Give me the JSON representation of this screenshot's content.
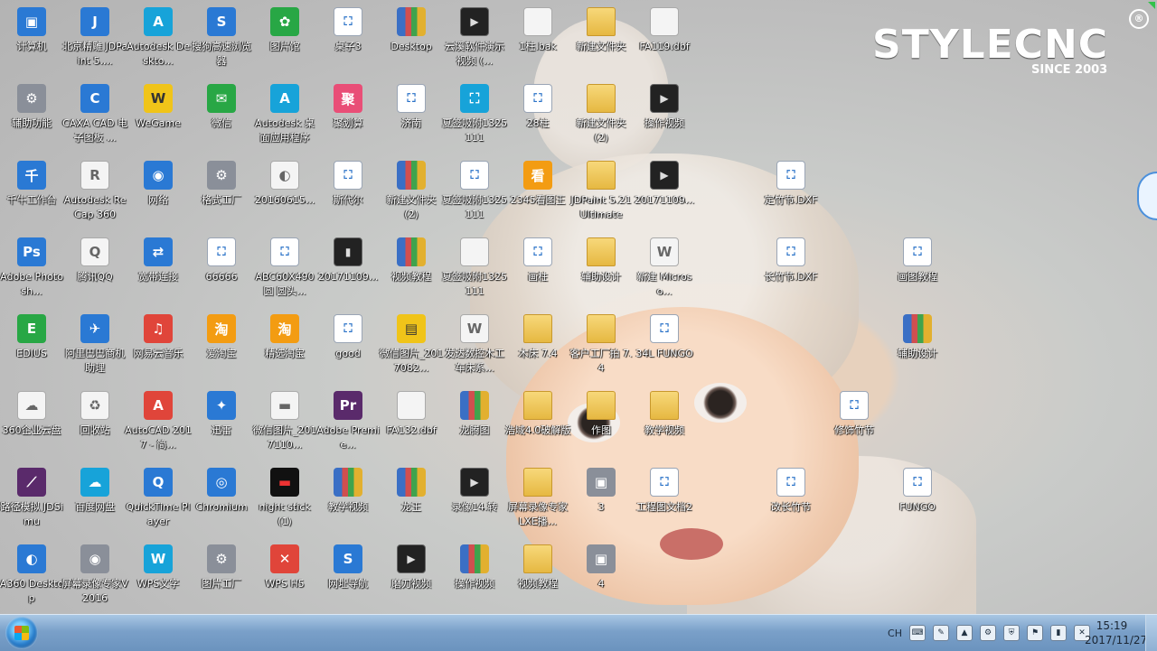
{
  "logo": {
    "brand": "STYLECNC",
    "since": "SINCE 2003",
    "reg": "®"
  },
  "desktop_icons": [
    {
      "label": "计算机",
      "icon": "computer-icon",
      "glyph": "▣",
      "type": "g-blue"
    },
    {
      "label": "北京精雕 JDPaint 5....",
      "icon": "jdpaint-icon",
      "glyph": "J",
      "type": "g-blue"
    },
    {
      "label": "Autodesk Deskto...",
      "icon": "autodesk-icon",
      "glyph": "A",
      "type": "g-cyan"
    },
    {
      "label": "搜狗高速浏览器",
      "icon": "browser-icon",
      "glyph": "S",
      "type": "g-blue"
    },
    {
      "label": "图片馆",
      "icon": "image-viewer-icon",
      "glyph": "✿",
      "type": "g-green"
    },
    {
      "label": "桌子3",
      "icon": "cad-file-icon",
      "glyph": "⛶",
      "type": "g-file"
    },
    {
      "label": "Desktop",
      "icon": "archive-icon",
      "glyph": "",
      "type": "g-rar"
    },
    {
      "label": "云溪软件演示视频 (...",
      "icon": "video-file-icon",
      "glyph": "▶",
      "type": "g-video"
    },
    {
      "label": "1柱.bak",
      "icon": "file-icon",
      "glyph": "",
      "type": "g-white"
    },
    {
      "label": "新建文件夹",
      "icon": "folder-icon",
      "glyph": "",
      "type": "g-folder"
    },
    {
      "label": "FA119.dbf",
      "icon": "file-icon",
      "glyph": "",
      "type": "g-white"
    },
    {
      "label": "辅助功能",
      "icon": "accessibility-icon",
      "glyph": "⚙",
      "type": "g-gray"
    },
    {
      "label": "CAXA CAD 电子图板 ...",
      "icon": "caxa-icon",
      "glyph": "C",
      "type": "g-blue"
    },
    {
      "label": "WeGame",
      "icon": "wegame-icon",
      "glyph": "W",
      "type": "g-yellow"
    },
    {
      "label": "微信",
      "icon": "wechat-icon",
      "glyph": "✉",
      "type": "g-green"
    },
    {
      "label": "Autodesk 桌面应用程序",
      "icon": "autodesk-icon",
      "glyph": "A",
      "type": "g-cyan"
    },
    {
      "label": "聚划算",
      "icon": "juhuasuan-icon",
      "glyph": "聚",
      "type": "g-pink"
    },
    {
      "label": "济南",
      "icon": "cad-file-icon",
      "glyph": "⛶",
      "type": "g-file"
    },
    {
      "label": "夏签吸附1325111",
      "icon": "cad-file-icon",
      "glyph": "⛶",
      "type": "g-cyan"
    },
    {
      "label": "28柱",
      "icon": "cad-file-icon",
      "glyph": "⛶",
      "type": "g-file"
    },
    {
      "label": "新建文件夹 (2)",
      "icon": "folder-icon",
      "glyph": "",
      "type": "g-folder"
    },
    {
      "label": "操作视频",
      "icon": "video-file-icon",
      "glyph": "▶",
      "type": "g-video"
    },
    {
      "label": "千牛工作台",
      "icon": "qianniu-icon",
      "glyph": "千",
      "type": "g-blue"
    },
    {
      "label": "Autodesk ReCap 360",
      "icon": "recap-icon",
      "glyph": "R",
      "type": "g-white"
    },
    {
      "label": "网络",
      "icon": "network-icon",
      "glyph": "◉",
      "type": "g-blue"
    },
    {
      "label": "格式工厂",
      "icon": "format-factory-icon",
      "glyph": "⚙",
      "type": "g-gray"
    },
    {
      "label": "20160615...",
      "icon": "image-file-icon",
      "glyph": "◐",
      "type": "g-white"
    },
    {
      "label": "斯代尔",
      "icon": "cad-file-icon",
      "glyph": "⛶",
      "type": "g-file"
    },
    {
      "label": "新建文件夹 (2)",
      "icon": "archive-icon",
      "glyph": "",
      "type": "g-rar"
    },
    {
      "label": "夏签吸附1325111",
      "icon": "cad-file-icon",
      "glyph": "⛶",
      "type": "g-file"
    },
    {
      "label": "2345看图王",
      "icon": "image-viewer-icon",
      "glyph": "看",
      "type": "g-orange"
    },
    {
      "label": "JDPaint 5.21 Ultimate",
      "icon": "folder-icon",
      "glyph": "",
      "type": "g-folder"
    },
    {
      "label": "20171109...",
      "icon": "video-file-icon",
      "glyph": "▶",
      "type": "g-video"
    },
    {
      "label": "定竹节.DXF",
      "icon": "cad-file-icon",
      "glyph": "⛶",
      "type": "g-file"
    },
    {
      "label": "Adobe Photosh...",
      "icon": "photoshop-icon",
      "glyph": "Ps",
      "type": "g-blue"
    },
    {
      "label": "腾讯QQ",
      "icon": "qq-icon",
      "glyph": "Q",
      "type": "g-white"
    },
    {
      "label": "宽带连接",
      "icon": "broadband-icon",
      "glyph": "⇄",
      "type": "g-blue"
    },
    {
      "label": "66666",
      "icon": "cad-file-icon",
      "glyph": "⛶",
      "type": "g-file"
    },
    {
      "label": "ABC60X490圆 圆头...",
      "icon": "cad-file-icon",
      "glyph": "⛶",
      "type": "g-file"
    },
    {
      "label": "20171109...",
      "icon": "video-file-icon",
      "glyph": "▮",
      "type": "g-video"
    },
    {
      "label": "视频教程",
      "icon": "archive-icon",
      "glyph": "",
      "type": "g-rar"
    },
    {
      "label": "夏签吸附1325111",
      "icon": "file-icon",
      "glyph": "",
      "type": "g-white"
    },
    {
      "label": "画柱",
      "icon": "cad-file-icon",
      "glyph": "⛶",
      "type": "g-file"
    },
    {
      "label": "辅助设计",
      "icon": "folder-icon",
      "glyph": "",
      "type": "g-folder"
    },
    {
      "label": "新建 Microso...",
      "icon": "word-file-icon",
      "glyph": "W",
      "type": "g-white"
    },
    {
      "label": "长竹节.DXF",
      "icon": "cad-file-icon",
      "glyph": "⛶",
      "type": "g-file"
    },
    {
      "label": "画图教程",
      "icon": "cad-file-icon",
      "glyph": "⛶",
      "type": "g-file"
    },
    {
      "label": "EDIUS",
      "icon": "edius-icon",
      "glyph": "E",
      "type": "g-green"
    },
    {
      "label": "阿里巴巴商机助理",
      "icon": "alibaba-icon",
      "glyph": "✈",
      "type": "g-blue"
    },
    {
      "label": "网易云音乐",
      "icon": "netease-music-icon",
      "glyph": "♫",
      "type": "g-red"
    },
    {
      "label": "爱淘宝",
      "icon": "taobao-icon",
      "glyph": "淘",
      "type": "g-orange"
    },
    {
      "label": "精选淘宝",
      "icon": "taobao-icon",
      "glyph": "淘",
      "type": "g-orange"
    },
    {
      "label": "good",
      "icon": "cad-file-icon",
      "glyph": "⛶",
      "type": "g-file"
    },
    {
      "label": "微信图片_2017082...",
      "icon": "image-file-icon",
      "glyph": "▤",
      "type": "g-yellow"
    },
    {
      "label": "发达数控木工车床系...",
      "icon": "word-file-icon",
      "glyph": "W",
      "type": "g-white"
    },
    {
      "label": "木床 7.4",
      "icon": "folder-icon",
      "glyph": "",
      "type": "g-folder"
    },
    {
      "label": "客户工厂拍 7.4",
      "icon": "folder-icon",
      "glyph": "",
      "type": "g-folder"
    },
    {
      "label": "34L FUNGO",
      "icon": "cad-file-icon",
      "glyph": "⛶",
      "type": "g-file"
    },
    {
      "label": "辅助设计",
      "icon": "archive-icon",
      "glyph": "",
      "type": "g-rar"
    },
    {
      "label": "360企业云盘",
      "icon": "cloud-drive-icon",
      "glyph": "☁",
      "type": "g-white"
    },
    {
      "label": "回收站",
      "icon": "recycle-bin-icon",
      "glyph": "♻",
      "type": "g-white"
    },
    {
      "label": "AutoCAD 2017 - 简...",
      "icon": "autocad-icon",
      "glyph": "A",
      "type": "g-red"
    },
    {
      "label": "迅雷",
      "icon": "xunlei-icon",
      "glyph": "✦",
      "type": "g-blue"
    },
    {
      "label": "微信图片_2017110...",
      "icon": "image-file-icon",
      "glyph": "▬",
      "type": "g-white"
    },
    {
      "label": "Adobe Premie...",
      "icon": "premiere-icon",
      "glyph": "Pr",
      "type": "g-purple"
    },
    {
      "label": "FA132.dbf",
      "icon": "file-icon",
      "glyph": "",
      "type": "g-white"
    },
    {
      "label": "龙腾图",
      "icon": "archive-icon",
      "glyph": "",
      "type": "g-rar"
    },
    {
      "label": "浩域4.0破解版",
      "icon": "folder-icon",
      "glyph": "",
      "type": "g-folder"
    },
    {
      "label": "作图",
      "icon": "folder-icon",
      "glyph": "",
      "type": "g-folder"
    },
    {
      "label": "教学视频",
      "icon": "folder-icon",
      "glyph": "",
      "type": "g-folder"
    },
    {
      "label": "修饰竹节",
      "icon": "cad-file-icon",
      "glyph": "⛶",
      "type": "g-file"
    },
    {
      "label": "路径模拟 JDSimu",
      "icon": "jdsimu-icon",
      "glyph": "⟋",
      "type": "g-purple"
    },
    {
      "label": "百度网盘",
      "icon": "baidu-pan-icon",
      "glyph": "☁",
      "type": "g-cyan"
    },
    {
      "label": "QuickTime Player",
      "icon": "quicktime-icon",
      "glyph": "Q",
      "type": "g-blue"
    },
    {
      "label": "Chromium",
      "icon": "chromium-icon",
      "glyph": "◎",
      "type": "g-blue"
    },
    {
      "label": "night stick (1)",
      "icon": "image-file-icon",
      "glyph": "▬",
      "type": "g-dark"
    },
    {
      "label": "教学视频",
      "icon": "archive-icon",
      "glyph": "",
      "type": "g-rar"
    },
    {
      "label": "龙王",
      "icon": "archive-icon",
      "glyph": "",
      "type": "g-rar"
    },
    {
      "label": "录像14.转",
      "icon": "video-file-icon",
      "glyph": "▶",
      "type": "g-video"
    },
    {
      "label": "屏幕录像专家 LXE播...",
      "icon": "folder-icon",
      "glyph": "",
      "type": "g-folder"
    },
    {
      "label": "3",
      "icon": "image-file-icon",
      "glyph": "▣",
      "type": "g-gray"
    },
    {
      "label": "工程图文档2",
      "icon": "cad-file-icon",
      "glyph": "⛶",
      "type": "g-file"
    },
    {
      "label": "改长竹节",
      "icon": "cad-file-icon",
      "glyph": "⛶",
      "type": "g-file"
    },
    {
      "label": "FUNGO",
      "icon": "cad-file-icon",
      "glyph": "⛶",
      "type": "g-file"
    },
    {
      "label": "A360 Desktop",
      "icon": "a360-icon",
      "glyph": "◐",
      "type": "g-blue"
    },
    {
      "label": "屏幕录像专家V2016",
      "icon": "screen-recorder-icon",
      "glyph": "◉",
      "type": "g-gray"
    },
    {
      "label": "WPS文字",
      "icon": "wps-writer-icon",
      "glyph": "W",
      "type": "g-cyan"
    },
    {
      "label": "图片工厂",
      "icon": "image-factory-icon",
      "glyph": "⚙",
      "type": "g-gray"
    },
    {
      "label": "WPS H5",
      "icon": "wps-h5-icon",
      "glyph": "✕",
      "type": "g-red"
    },
    {
      "label": "网址导航",
      "icon": "navigation-icon",
      "glyph": "S",
      "type": "g-blue"
    },
    {
      "label": "磨刀视频",
      "icon": "video-file-icon",
      "glyph": "▶",
      "type": "g-video"
    },
    {
      "label": "操作视频",
      "icon": "archive-icon",
      "glyph": "",
      "type": "g-rar"
    },
    {
      "label": "视频教程",
      "icon": "folder-icon",
      "glyph": "",
      "type": "g-folder"
    },
    {
      "label": "4",
      "icon": "image-file-icon",
      "glyph": "▣",
      "type": "g-gray"
    }
  ],
  "taskbar": {
    "tray_lang": "CH",
    "time": "15:19",
    "date": "2017/11/27"
  }
}
